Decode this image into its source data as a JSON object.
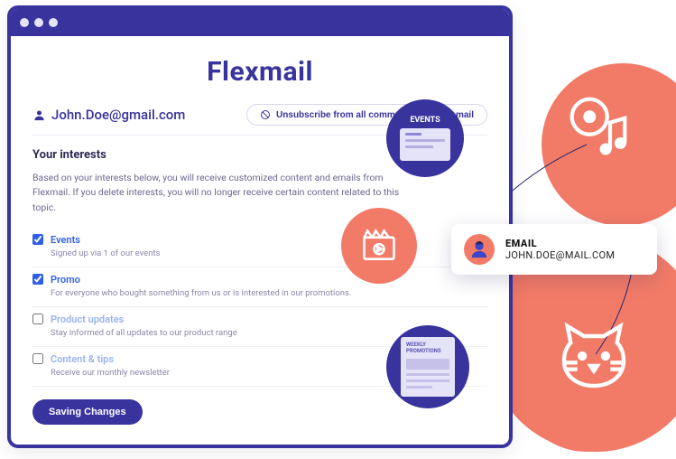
{
  "app": {
    "brand": "Flexmail"
  },
  "user": {
    "email_display": "John.Doe@gmail.com"
  },
  "actions": {
    "unsubscribe_label": "Unsubscribe from all communication by email",
    "save_label": "Saving Changes"
  },
  "interests_section": {
    "title": "Your interests",
    "intro": "Based on your interests below, you will receive customized content and emails from Flexmail. If you delete interests, you will no longer receive certain content related to this topic."
  },
  "interests": [
    {
      "label": "Events",
      "description": "Signed up via 1 of our events",
      "checked": true
    },
    {
      "label": "Promo",
      "description": "For everyone who bought something from us or is interested in our promotions.",
      "checked": true
    },
    {
      "label": "Product updates",
      "description": "Stay informed of all updates to our product range",
      "checked": false
    },
    {
      "label": "Content & tips",
      "description": "Receive our monthly newsletter",
      "checked": false
    }
  ],
  "badges": {
    "events_label": "EVENTS",
    "promotions_line1": "WEEKLY",
    "promotions_line2": "PROMOTIONS"
  },
  "email_card": {
    "label": "EMAIL",
    "value": "JOHN.DOE@MAIL.COM"
  }
}
